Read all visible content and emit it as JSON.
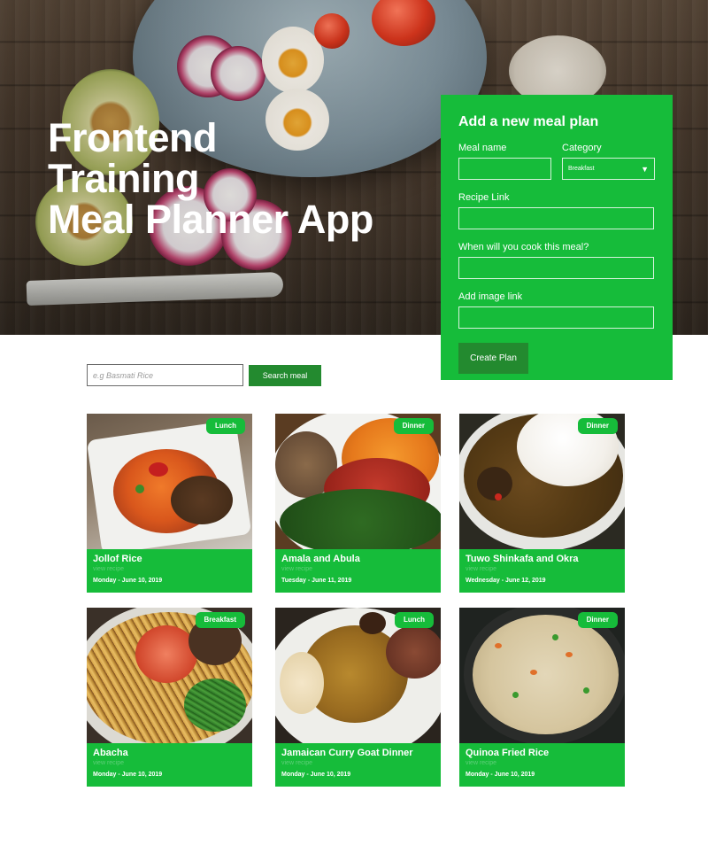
{
  "hero": {
    "title_lines": [
      "Frontend",
      "Training",
      "Meal Planner App"
    ]
  },
  "form": {
    "title": "Add a new meal plan",
    "meal_name_label": "Meal name",
    "meal_name_value": "",
    "category_label": "Category",
    "category_selected": "Breakfast",
    "recipe_link_label": "Recipe Link",
    "recipe_link_value": "",
    "cook_date_label": "When will you cook this meal?",
    "cook_date_value": "",
    "image_link_label": "Add image link",
    "image_link_value": "",
    "submit_label": "Create Plan"
  },
  "search": {
    "placeholder": "e.g Basmati Rice",
    "button_label": "Search meal"
  },
  "meals": [
    {
      "name": "Jollof Rice",
      "category": "Lunch",
      "link_text": "view recipe",
      "date": "Monday - June 10, 2019"
    },
    {
      "name": "Amala and Abula",
      "category": "Dinner",
      "link_text": "view recipe",
      "date": "Tuesday - June 11, 2019"
    },
    {
      "name": "Tuwo Shinkafa and Okra",
      "category": "Dinner",
      "link_text": "view recipe",
      "date": "Wednesday - June 12, 2019"
    },
    {
      "name": "Abacha",
      "category": "Breakfast",
      "link_text": "view recipe",
      "date": "Monday - June 10, 2019"
    },
    {
      "name": "Jamaican Curry Goat Dinner",
      "category": "Lunch",
      "link_text": "view recipe",
      "date": "Monday - June 10, 2019"
    },
    {
      "name": "Quinoa Fried Rice",
      "category": "Dinner",
      "link_text": "view recipe",
      "date": "Monday - June 10, 2019"
    }
  ],
  "colors": {
    "brand_green": "#16bc3a",
    "dark_green": "#238a2f"
  },
  "icons": {
    "select_arrow": "dropdown-arrow-icon"
  }
}
